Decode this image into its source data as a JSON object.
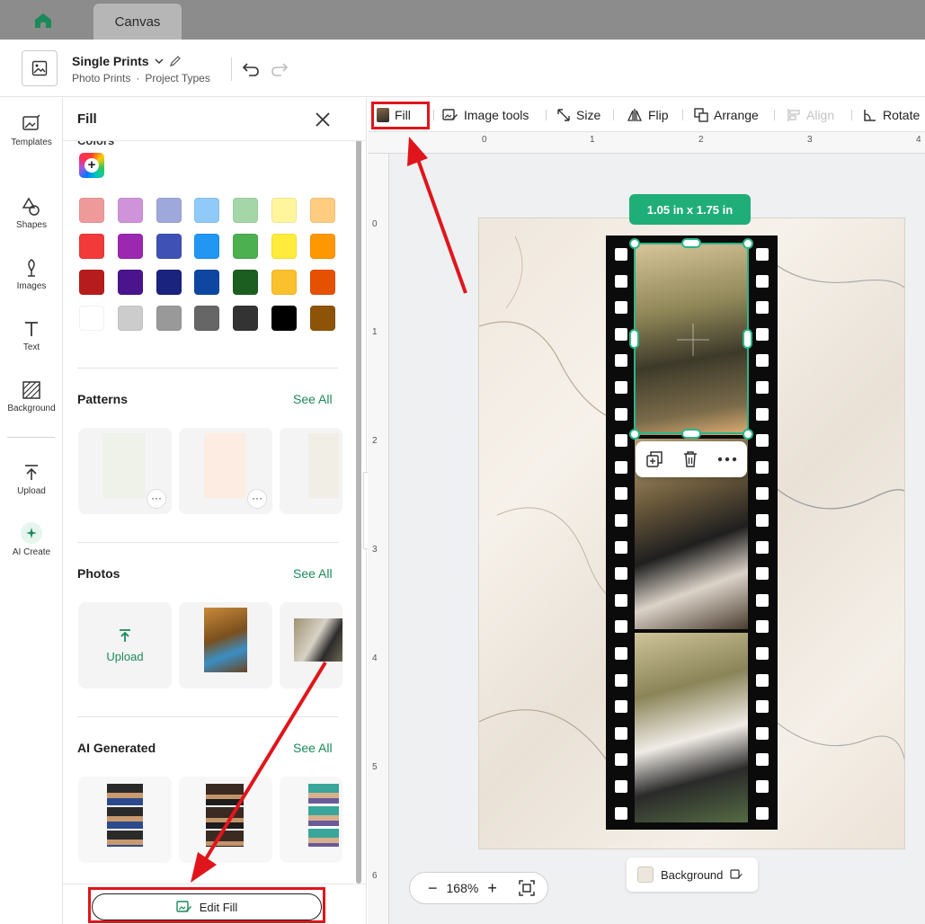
{
  "tabbar": {
    "tab_label": "Canvas"
  },
  "header": {
    "title": "Single Prints",
    "breadcrumb": [
      "Photo Prints",
      "Project Types"
    ]
  },
  "rail": {
    "items": [
      {
        "label": "Templates",
        "icon": "templates-icon"
      },
      {
        "label": "Shapes",
        "icon": "shapes-icon"
      },
      {
        "label": "Images",
        "icon": "images-icon"
      },
      {
        "label": "Text",
        "icon": "text-icon"
      },
      {
        "label": "Background",
        "icon": "background-icon"
      },
      {
        "label": "Upload",
        "icon": "upload-icon"
      },
      {
        "label": "AI Create",
        "icon": "ai-create-icon"
      }
    ]
  },
  "panel": {
    "title": "Fill",
    "colors_label": "Colors",
    "swatches": [
      "#ef9a9a",
      "#ce93d8",
      "#9fa8da",
      "#90caf9",
      "#a5d6a7",
      "#fff59d",
      "#ffcc80",
      "#f23a3a",
      "#9c27b0",
      "#3f51b5",
      "#2196f3",
      "#4caf50",
      "#ffeb3b",
      "#ff9800",
      "#b71c1c",
      "#4a148c",
      "#1a237e",
      "#0d47a1",
      "#1b5e20",
      "#fbc02d",
      "#e65100",
      "#ffffff",
      "#cccccc",
      "#999999",
      "#666666",
      "#333333",
      "#000000",
      "#8d5408"
    ],
    "sections": {
      "patterns": {
        "title": "Patterns",
        "see_all": "See All"
      },
      "photos": {
        "title": "Photos",
        "see_all": "See All",
        "upload_label": "Upload"
      },
      "ai": {
        "title": "AI Generated",
        "see_all": "See All"
      }
    },
    "edit_fill_label": "Edit Fill"
  },
  "toolbar": {
    "fill": "Fill",
    "image_tools": "Image tools",
    "size": "Size",
    "flip": "Flip",
    "arrange": "Arrange",
    "align": "Align",
    "rotate": "Rotate"
  },
  "canvas": {
    "ruler_h": [
      "0",
      "1",
      "2",
      "3",
      "4"
    ],
    "ruler_v": [
      "0",
      "1",
      "2",
      "3",
      "4",
      "5",
      "6"
    ],
    "dimension_label": "1.05  in x 1.75  in",
    "background_label": "Background",
    "zoom_level": "168%"
  },
  "colors": {
    "accent": "#1b8a5a",
    "selection": "#2db489",
    "highlight": "#e0151b"
  }
}
